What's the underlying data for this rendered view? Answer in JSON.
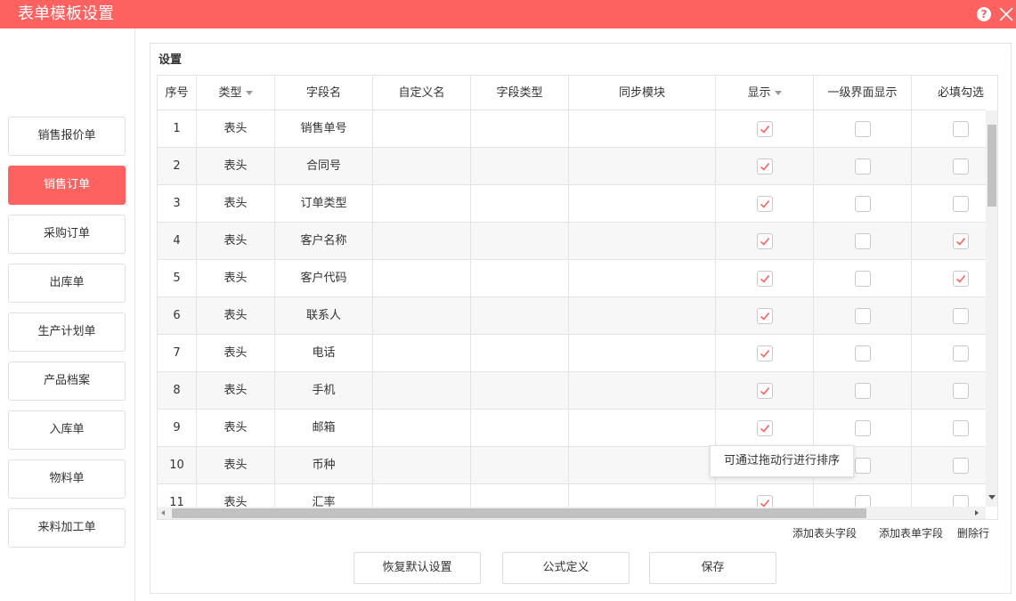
{
  "window": {
    "title": "表单模板设置"
  },
  "sidebar": {
    "items": [
      {
        "label": "销售报价单",
        "active": false
      },
      {
        "label": "销售订单",
        "active": true
      },
      {
        "label": "采购订单",
        "active": false
      },
      {
        "label": "出库单",
        "active": false
      },
      {
        "label": "生产计划单",
        "active": false
      },
      {
        "label": "产品档案",
        "active": false
      },
      {
        "label": "入库单",
        "active": false
      },
      {
        "label": "物料单",
        "active": false
      },
      {
        "label": "来料加工单",
        "active": false
      }
    ]
  },
  "panel": {
    "title": "设置"
  },
  "table": {
    "columns": [
      "序号",
      "类型",
      "字段名",
      "自定义名",
      "字段类型",
      "同步模块",
      "显示",
      "一级界面显示",
      "必填勾选"
    ],
    "rows": [
      {
        "no": "1",
        "type": "表头",
        "field": "销售单号",
        "custom": "",
        "ftype": "",
        "sync": "",
        "show": true,
        "level1": false,
        "required": false
      },
      {
        "no": "2",
        "type": "表头",
        "field": "合同号",
        "custom": "",
        "ftype": "",
        "sync": "",
        "show": true,
        "level1": false,
        "required": false
      },
      {
        "no": "3",
        "type": "表头",
        "field": "订单类型",
        "custom": "",
        "ftype": "",
        "sync": "",
        "show": true,
        "level1": false,
        "required": false
      },
      {
        "no": "4",
        "type": "表头",
        "field": "客户名称",
        "custom": "",
        "ftype": "",
        "sync": "",
        "show": true,
        "level1": false,
        "required": true
      },
      {
        "no": "5",
        "type": "表头",
        "field": "客户代码",
        "custom": "",
        "ftype": "",
        "sync": "",
        "show": true,
        "level1": false,
        "required": true
      },
      {
        "no": "6",
        "type": "表头",
        "field": "联系人",
        "custom": "",
        "ftype": "",
        "sync": "",
        "show": true,
        "level1": false,
        "required": false
      },
      {
        "no": "7",
        "type": "表头",
        "field": "电话",
        "custom": "",
        "ftype": "",
        "sync": "",
        "show": true,
        "level1": false,
        "required": false
      },
      {
        "no": "8",
        "type": "表头",
        "field": "手机",
        "custom": "",
        "ftype": "",
        "sync": "",
        "show": true,
        "level1": false,
        "required": false
      },
      {
        "no": "9",
        "type": "表头",
        "field": "邮箱",
        "custom": "",
        "ftype": "",
        "sync": "",
        "show": true,
        "level1": false,
        "required": false
      },
      {
        "no": "10",
        "type": "表头",
        "field": "币种",
        "custom": "",
        "ftype": "",
        "sync": "",
        "show": true,
        "level1": false,
        "required": false
      },
      {
        "no": "11",
        "type": "表头",
        "field": "汇率",
        "custom": "",
        "ftype": "",
        "sync": "",
        "show": true,
        "level1": false,
        "required": false
      }
    ]
  },
  "tooltip": {
    "text": "可通过拖动行进行排序"
  },
  "links": {
    "add_header_field": "添加表头字段",
    "add_form_field": "添加表单字段",
    "delete_row": "删除行"
  },
  "buttons": {
    "restore": "恢复默认设置",
    "formula": "公式定义",
    "save": "保存"
  },
  "colors": {
    "accent": "#fd6160",
    "check": "#fd6160"
  }
}
